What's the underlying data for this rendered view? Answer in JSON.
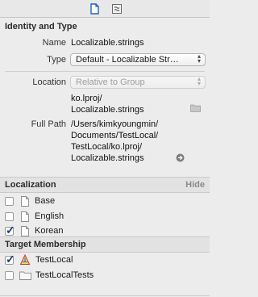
{
  "identity": {
    "header": "Identity and Type",
    "name_label": "Name",
    "name_value": "Localizable.strings",
    "type_label": "Type",
    "type_value": "Default - Localizable Str…",
    "location_label": "Location",
    "location_value": "Relative to Group",
    "location_path_line1": "ko.lproj/",
    "location_path_line2": "Localizable.strings",
    "fullpath_label": "Full Path",
    "fullpath_line1": "/Users/kimkyoungmin/",
    "fullpath_line2": "Documents/TestLocal/",
    "fullpath_line3": "TestLocal/ko.lproj/",
    "fullpath_line4": "Localizable.strings"
  },
  "localization": {
    "header": "Localization",
    "hide_label": "Hide",
    "items": [
      {
        "label": "Base",
        "checked": false
      },
      {
        "label": "English",
        "checked": false
      },
      {
        "label": "Korean",
        "checked": true
      }
    ]
  },
  "target_membership": {
    "header": "Target Membership",
    "items": [
      {
        "label": "TestLocal",
        "checked": true,
        "icon": "app-target-icon"
      },
      {
        "label": "TestLocalTests",
        "checked": false,
        "icon": "test-bundle-icon"
      }
    ]
  },
  "colors": {
    "accent": "#1f5fc8",
    "check": "#1e3a70"
  }
}
